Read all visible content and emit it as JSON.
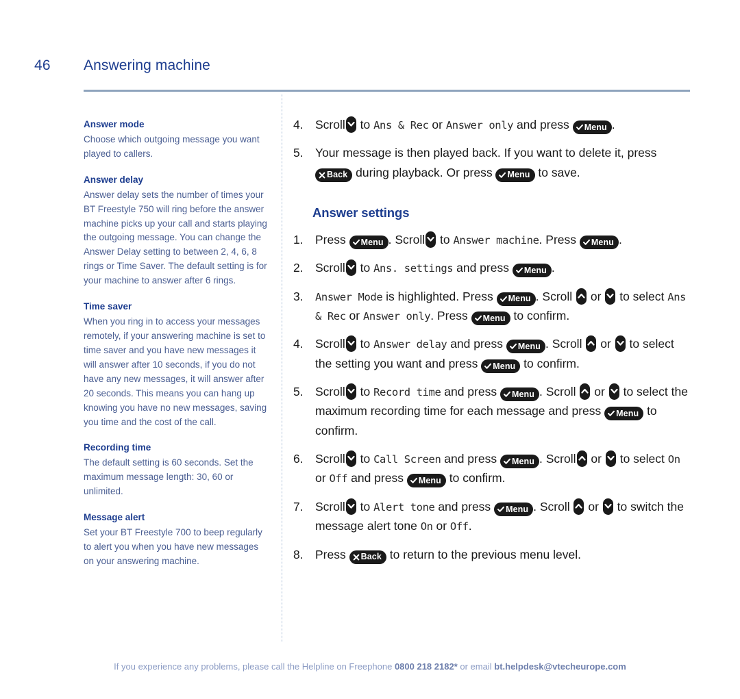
{
  "page": {
    "number": "46",
    "title": "Answering machine"
  },
  "colors": {
    "heading_blue": "#1d3d8f",
    "body_blue": "#4a5e92",
    "rule": "#8fa4bd",
    "divider": "#a8bcd6",
    "key_black": "#1a1a1a",
    "footer": "#8c9cc4"
  },
  "keys": {
    "menu": {
      "label": "Menu",
      "icon": "check-icon"
    },
    "back": {
      "label": "Back",
      "icon": "cross-icon"
    },
    "scroll_down": {
      "icon": "chevron-down-icon"
    },
    "scroll_up": {
      "icon": "chevron-up-icon"
    }
  },
  "sidebar": {
    "blocks": [
      {
        "heading": "Answer mode",
        "body": "Choose which outgoing message you want played to callers."
      },
      {
        "heading": "Answer delay",
        "body": "Answer delay sets the number of times your BT Freestyle 750 will ring before the answer machine picks up your call and starts playing the outgoing message. You can change the Answer Delay setting to between 2, 4, 6, 8 rings or Time Saver. The default setting is for your machine to answer after 6 rings."
      },
      {
        "heading": "Time saver",
        "body": "When you ring in to access your messages remotely, if your answering machine is set to time saver and you have new messages it will answer after 10 seconds, if you do not have any new messages, it will answer after 20 seconds. This means you can hang up knowing you have no new messages, saving you time and the cost of the call."
      },
      {
        "heading": "Recording time",
        "body": "The default setting is 60 seconds. Set the maximum message length: 30, 60 or unlimited."
      },
      {
        "heading": "Message alert",
        "body": "Set your BT Freestyle 700 to beep regularly to alert you when you have new messages on your answering machine."
      }
    ]
  },
  "content": {
    "top_steps": {
      "s4": {
        "num": "4.",
        "t1": "Scroll",
        "t2": "to",
        "lcd1": "Ans & Rec",
        "t3": "or",
        "lcd2": "Answer only",
        "t4": "and press",
        "t5": "."
      },
      "s5": {
        "num": "5.",
        "t1": "Your message is then played back. If you want to delete it, press",
        "t2": "during playback. Or press",
        "t3": "to save."
      }
    },
    "section_heading": "Answer settings",
    "steps": {
      "s1": {
        "num": "1.",
        "t1": "Press",
        "t2": ". Scroll",
        "t3": "to",
        "lcd1": "Answer machine",
        "t4": ". Press",
        "t5": "."
      },
      "s2": {
        "num": "2.",
        "t1": "Scroll",
        "t2": "to",
        "lcd1": "Ans. settings",
        "t3": "and press",
        "t4": "."
      },
      "s3": {
        "num": "3.",
        "lcd1": "Answer Mode",
        "t1": "is highlighted. Press",
        "t2": ". Scroll",
        "t3": "or",
        "t4": "to select",
        "lcd2": "Ans & Rec",
        "t5": "or",
        "lcd3": "Answer only",
        "t6": ". Press",
        "t7": "to confirm."
      },
      "s4": {
        "num": "4.",
        "t1": "Scroll",
        "t2": "to",
        "lcd1": "Answer delay",
        "t3": "and press",
        "t4": ". Scroll",
        "t5": "or",
        "t6": "to select the setting you want and press",
        "t7": "to confirm."
      },
      "s5": {
        "num": "5.",
        "t1": "Scroll",
        "t2": "to",
        "lcd1": "Record time",
        "t3": "and press",
        "t4": ". Scroll",
        "t5": "or",
        "t6": "to select the maximum recording time for each message and press",
        "t7": "to confirm."
      },
      "s6": {
        "num": "6.",
        "t1": "Scroll",
        "t2": "to",
        "lcd1": "Call Screen",
        "t3": "and press",
        "t4": ". Scroll",
        "t5": "or",
        "t6": "to select",
        "lcd2": "On",
        "t7": "or",
        "lcd3": "Off",
        "t8": "and press",
        "t9": "to confirm."
      },
      "s7": {
        "num": "7.",
        "t1": "Scroll",
        "t2": "to",
        "lcd1": "Alert tone",
        "t3": "and press",
        "t4": ". Scroll",
        "t5": "or",
        "t6": "to switch the message alert tone",
        "lcd2": "On",
        "t7": "or",
        "lcd3": "Off",
        "t8": "."
      },
      "s8": {
        "num": "8.",
        "t1": "Press",
        "t2": "to return to the previous menu level."
      }
    }
  },
  "footer": {
    "part1": "If you experience any problems, please call the Helpline on Freephone",
    "phone": "0800 218 2182*",
    "part2": "or email",
    "email": "bt.helpdesk@vtecheurope.com"
  }
}
